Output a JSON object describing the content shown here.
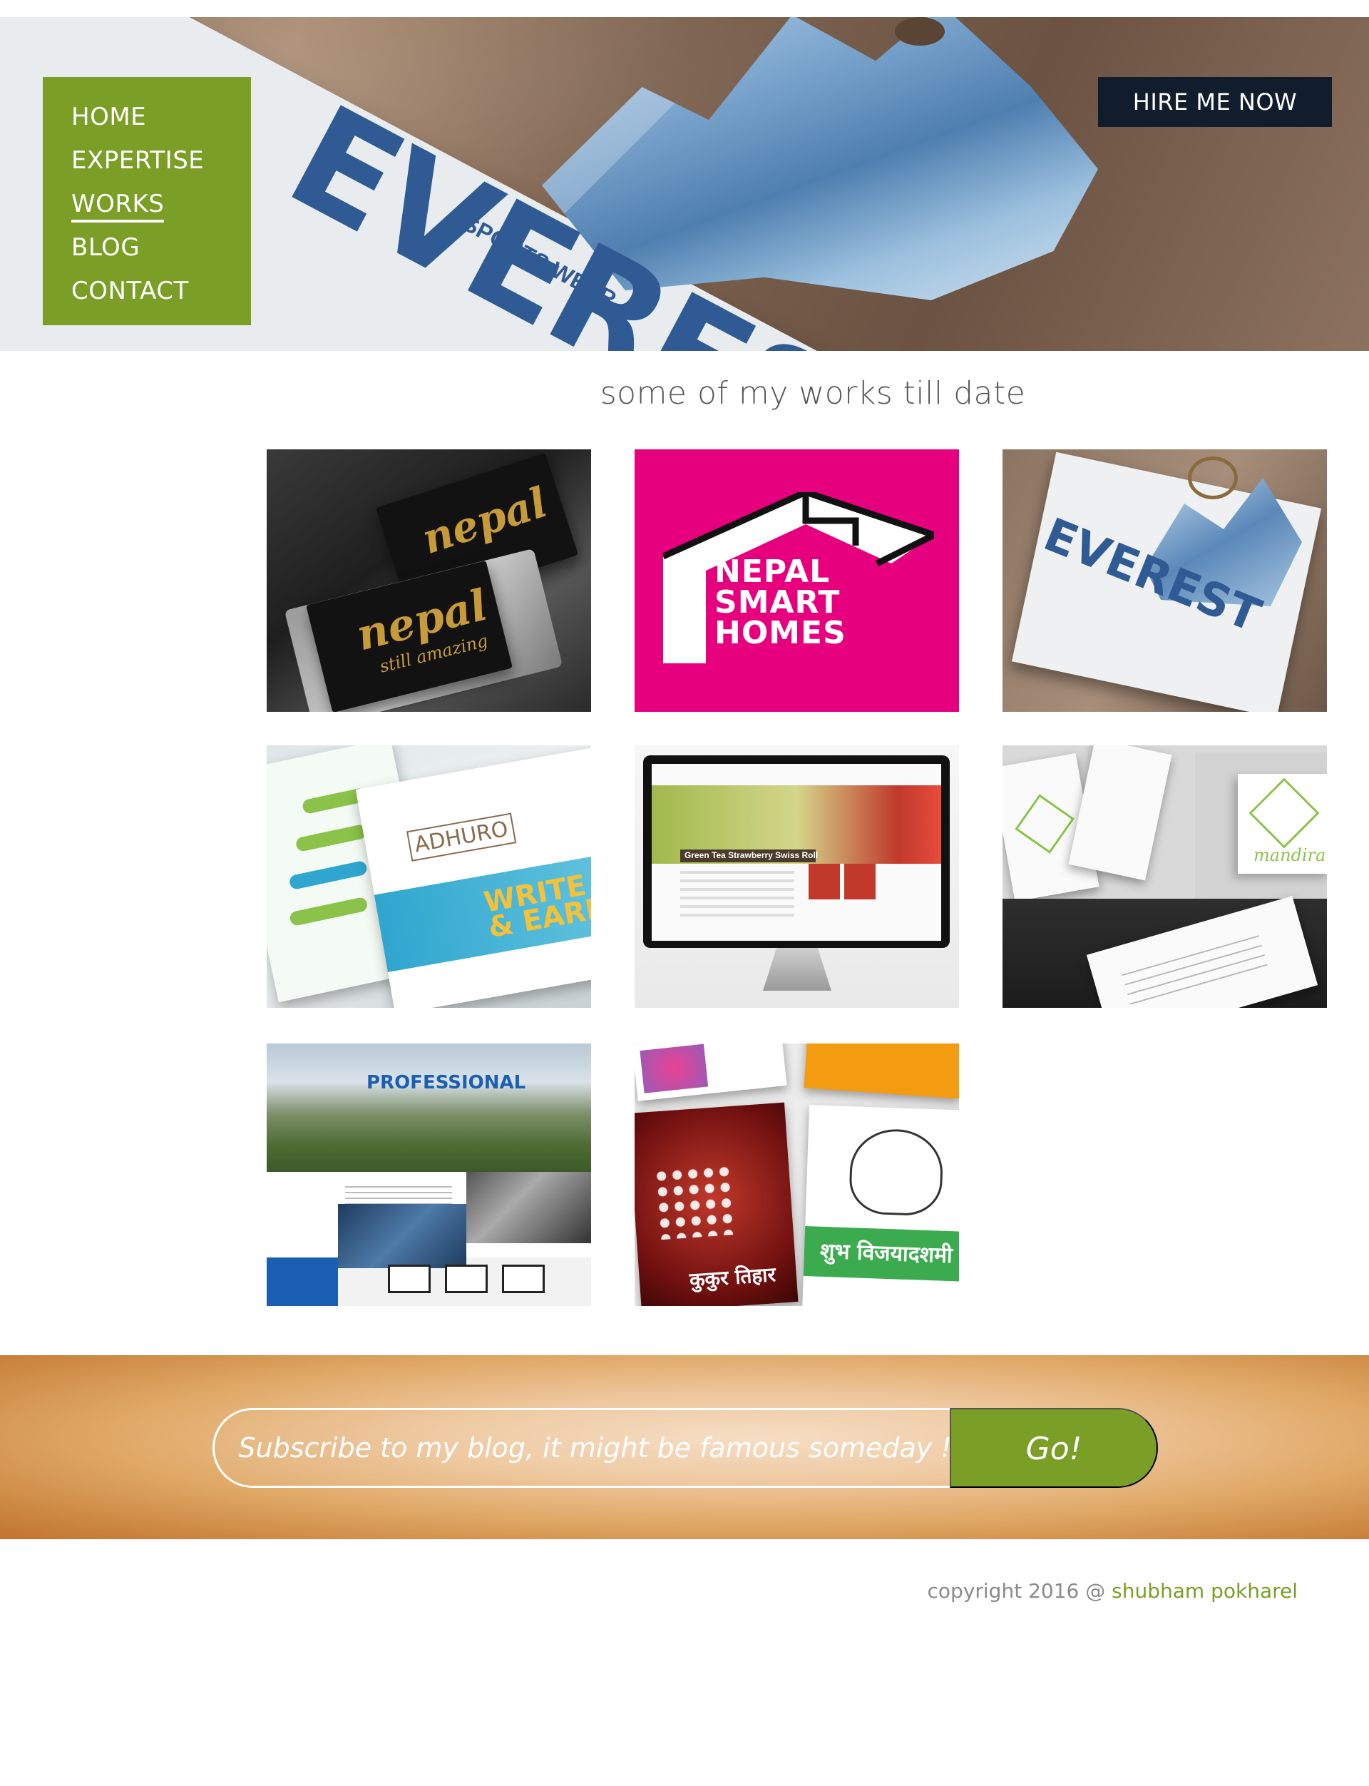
{
  "nav": {
    "items": [
      {
        "label": "HOME",
        "active": false
      },
      {
        "label": "EXPERTISE",
        "active": false
      },
      {
        "label": "WORKS",
        "active": true
      },
      {
        "label": "BLOG",
        "active": false
      },
      {
        "label": "CONTACT",
        "active": false
      }
    ]
  },
  "hire_button": "HIRE ME NOW",
  "hero": {
    "brand": "EVEREST",
    "brand_sub": "SPORTS WEAR"
  },
  "works": {
    "title": "some of my works till date",
    "tiles": [
      {
        "name": "nepal-still-amazing-cards",
        "text": "nepal",
        "text2": "still amazing"
      },
      {
        "name": "nepal-smart-homes-logo",
        "text": "NEPAL\nSMART\nHOMES"
      },
      {
        "name": "everest-tag",
        "text": "EVEREST"
      },
      {
        "name": "adhuro-brochure",
        "text": "ADHURO",
        "text2": "WRITE & EARN"
      },
      {
        "name": "green-tea-website",
        "text": "Green Tea Strawberry Swiss Roll"
      },
      {
        "name": "mandira-branding",
        "text": "mandira"
      },
      {
        "name": "professional-website",
        "text": "PROFESSIONAL"
      },
      {
        "name": "festival-posts",
        "text": "कुकुर तिहार",
        "text2": "शुभ विजयादशमी"
      }
    ]
  },
  "subscribe": {
    "placeholder": "Subscribe to my blog, it might be famous someday !",
    "button": "Go!"
  },
  "footer": {
    "copyright": "copyright 2016 @ ",
    "name": "shubham pokharel"
  },
  "colors": {
    "accent_green": "#7a9e26",
    "dark_navy": "#111d2c",
    "text_gray": "#555555"
  }
}
